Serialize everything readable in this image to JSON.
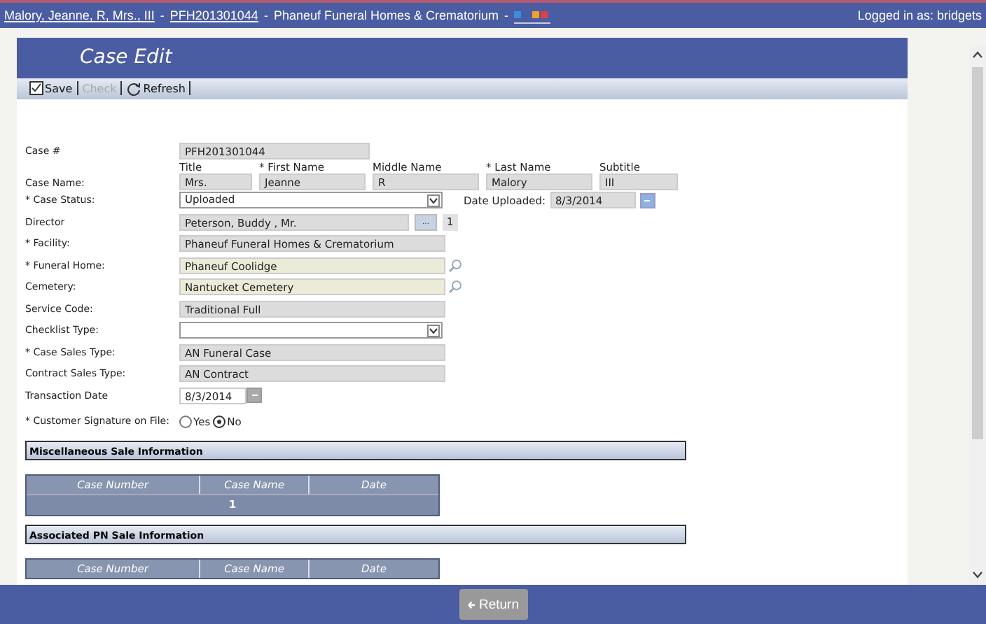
{
  "header": {
    "links": [
      "Malory, Jeanne, R, Mrs., III",
      "PFH201301044"
    ],
    "facility": "Phaneuf Funeral Homes & Crematorium",
    "separator": "-",
    "user": "Logged in as: bridgets"
  },
  "page_title": "Case Edit",
  "toolbar": [
    {
      "label": "Save",
      "disabled": false,
      "kind": "save"
    },
    {
      "label": "Check",
      "disabled": true,
      "kind": "plain"
    },
    {
      "label": "Refresh",
      "disabled": false,
      "kind": "refresh"
    }
  ],
  "form": [
    {
      "kind": "text",
      "label": "Case #",
      "value": "PFH201301044"
    },
    {
      "kind": "name",
      "label": "Case Name:",
      "parts": [
        {
          "label": "Title",
          "value": "Mrs."
        },
        {
          "label": "* First Name",
          "value": "Jeanne"
        },
        {
          "label": "Middle Name",
          "value": "R"
        },
        {
          "label": "* Last Name",
          "value": "Malory"
        },
        {
          "label": "Subtitle",
          "value": "III"
        }
      ]
    },
    {
      "kind": "select",
      "label": "* Case Status:",
      "value": "Uploaded",
      "extra_label": "Date Uploaded:",
      "extra_value": "8/3/2014"
    },
    {
      "kind": "lookup",
      "label": "Director",
      "value": "Peterson, Buddy , Mr.",
      "button": "...",
      "count": "1"
    },
    {
      "kind": "text",
      "label": "* Facility:",
      "value": "Phaneuf Funeral Homes & Crematorium"
    },
    {
      "kind": "search",
      "label": "* Funeral Home:",
      "value": "Phaneuf Coolidge"
    },
    {
      "kind": "search",
      "label": "Cemetery:",
      "value": "Nantucket Cemetery"
    },
    {
      "kind": "text",
      "label": "Service Code:",
      "value": "Traditional Full"
    },
    {
      "kind": "select",
      "label": "Checklist Type:"
    },
    {
      "kind": "text",
      "label": "* Case Sales Type:",
      "value": "AN Funeral Case"
    },
    {
      "kind": "text",
      "label": "Contract Sales Type:",
      "value": "AN Contract"
    },
    {
      "kind": "date",
      "label": "Transaction Date",
      "value": "8/3/2014"
    },
    {
      "kind": "radio",
      "label": "* Customer Signature on File:",
      "options": [
        {
          "label": "Yes",
          "selected": false
        },
        {
          "label": "No",
          "selected": true
        }
      ]
    }
  ],
  "sections": [
    {
      "title": "Miscellaneous Sale Information",
      "columns": [
        "Case Number",
        "Case Name",
        "Date"
      ],
      "pager": "1"
    },
    {
      "title": "Associated PN Sale Information",
      "columns": [
        "Case Number",
        "Case Name",
        "Date"
      ]
    }
  ],
  "return_button": "Return"
}
